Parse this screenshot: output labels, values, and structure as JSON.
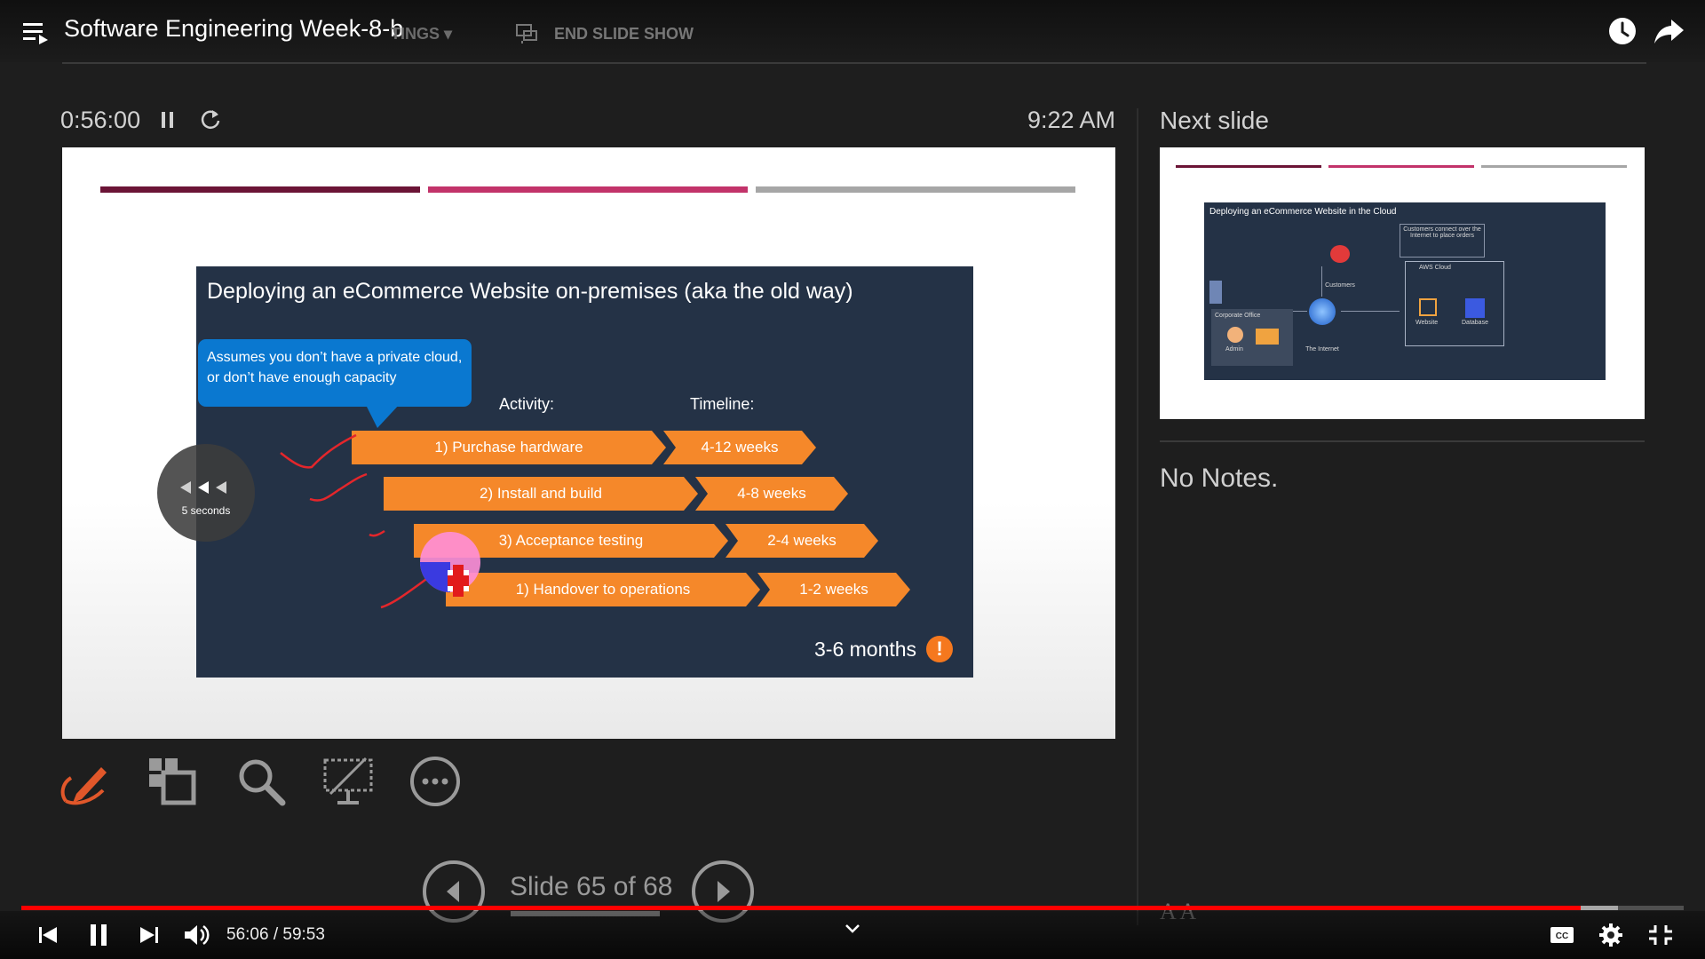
{
  "window": {
    "title": "Software Engineering Week-8-b",
    "ghost_settings": "TINGS ▾",
    "end_slide_show": "END SLIDE SHOW"
  },
  "presenter": {
    "elapsed_time": "0:56:00",
    "clock_time": "9:22 AM",
    "next_slide_label": "Next slide",
    "notes": "No Notes.",
    "font_icons": "A A",
    "slide_counter": "Slide 65 of 68"
  },
  "current_slide": {
    "stripe_colors": [
      "#6b1436",
      "#c2336a",
      "#a6a6a6"
    ],
    "title": "Deploying an eCommerce Website on-premises (aka the old way)",
    "callout": "Assumes you don’t have a private cloud, or don’t have enough capacity",
    "activity_header": "Activity:",
    "timeline_header": "Timeline:",
    "rows": [
      {
        "activity": "1) Purchase hardware",
        "timeline": "4-12 weeks"
      },
      {
        "activity": "2) Install and build",
        "timeline": "4-8 weeks"
      },
      {
        "activity": "3) Acceptance testing",
        "timeline": "2-4 weeks"
      },
      {
        "activity": "1) Handover to operations",
        "timeline": "1-2 weeks"
      }
    ],
    "total": "3-6 months",
    "warning": "!"
  },
  "next_slide": {
    "title": "Deploying an eCommerce Website in the Cloud",
    "note_box": "Customers connect over the Internet to place orders",
    "labels": {
      "customers": "Customers",
      "corporate_office": "Corporate Office",
      "admin": "Admin",
      "internet": "The Internet",
      "aws_cloud": "AWS Cloud",
      "website": "Website",
      "database": "Database"
    }
  },
  "seek_overlay": {
    "label": "5 seconds"
  },
  "player": {
    "time_display": "56:06 / 59:53",
    "progress": 0.9378,
    "buffered": 0.9607,
    "accent": "#ff0000"
  },
  "icons": {
    "tools": [
      "pen-icon",
      "see-all-slides-icon",
      "zoom-icon",
      "black-screen-icon",
      "more-options-icon"
    ]
  }
}
